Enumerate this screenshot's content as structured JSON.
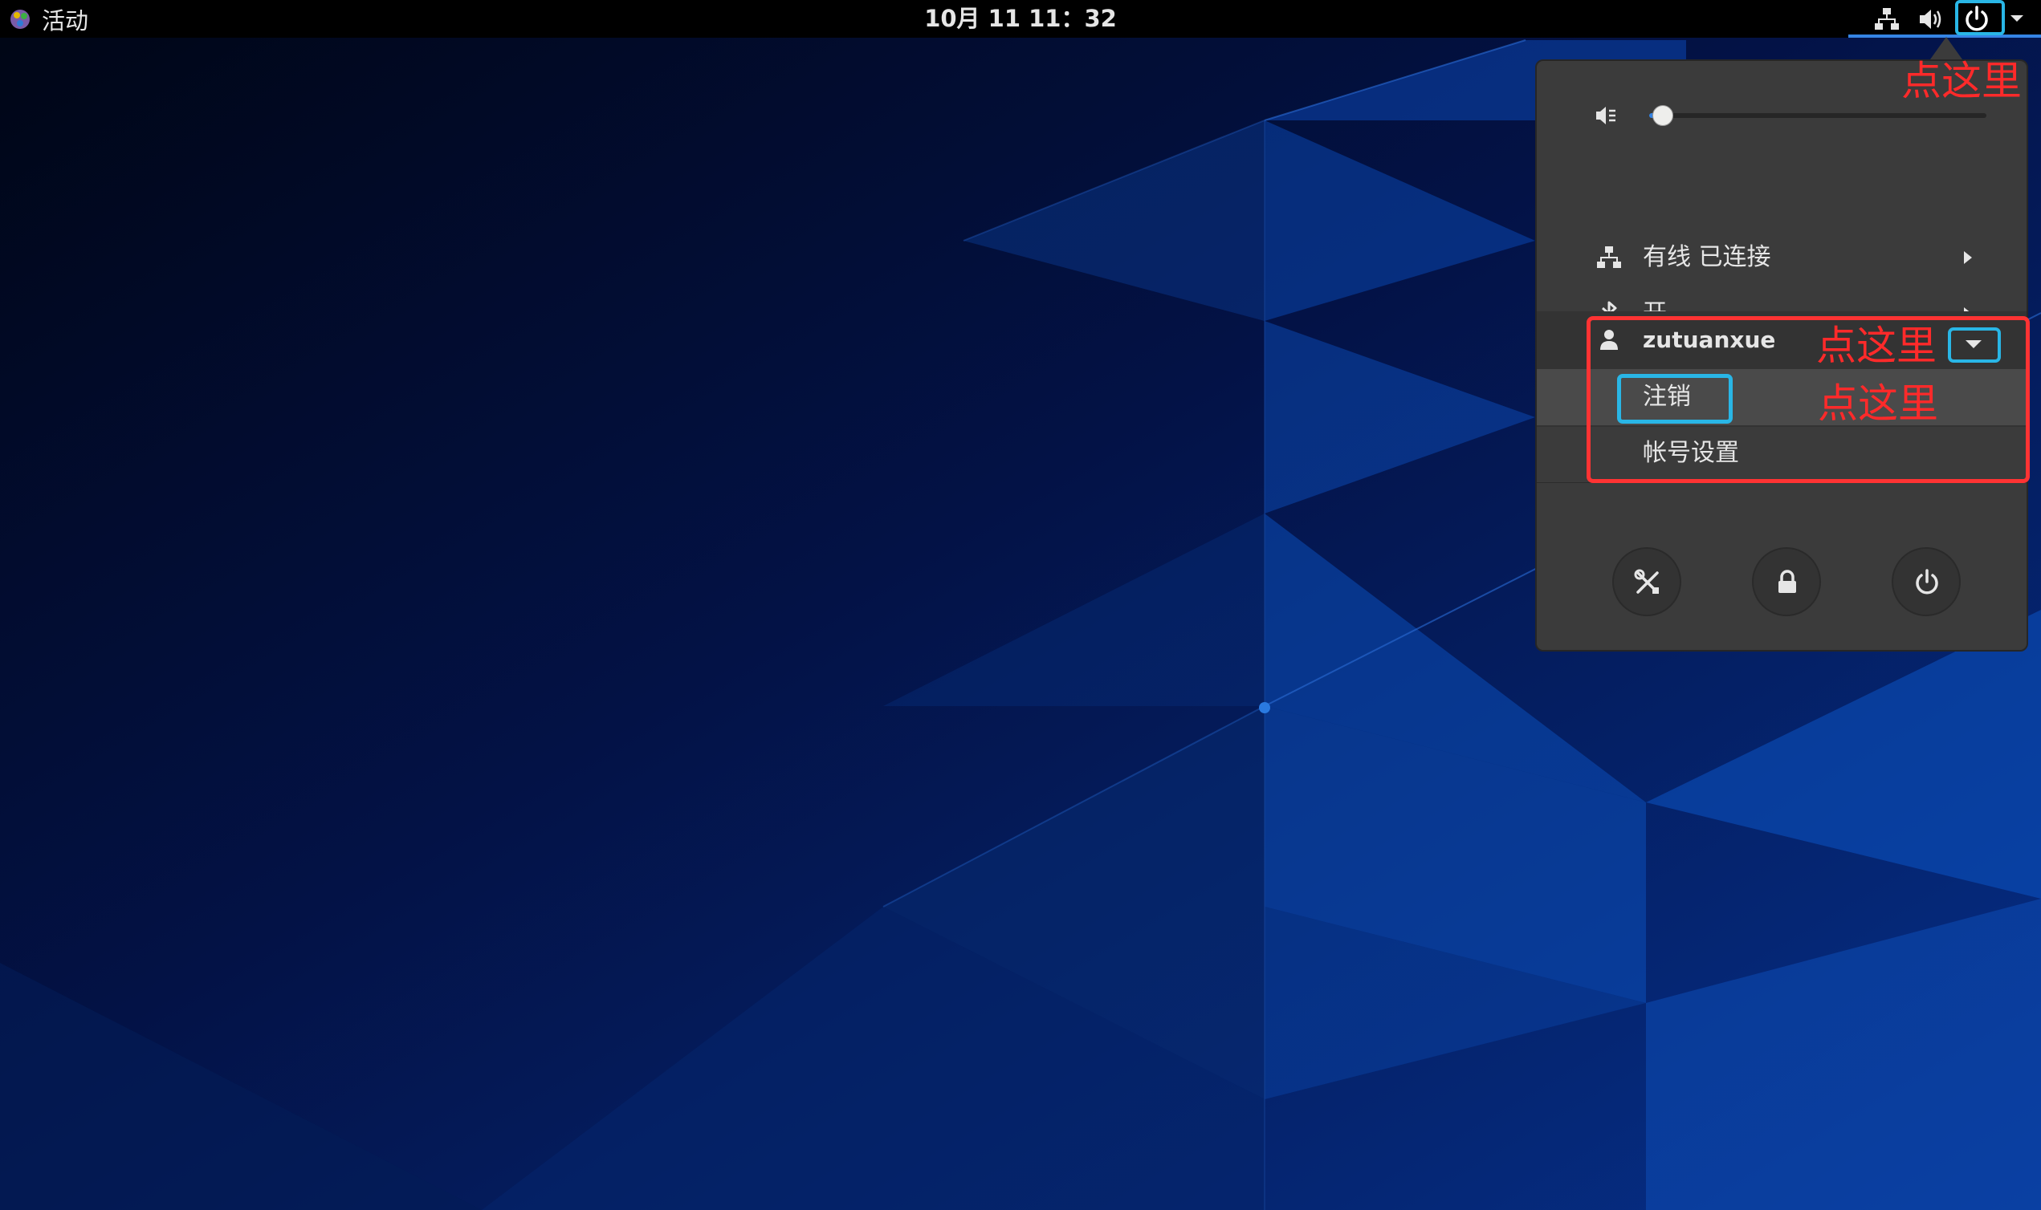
{
  "topbar": {
    "activities_label": "活动",
    "clock": "10月 11  11：32"
  },
  "menu": {
    "volume": {
      "level": 0.04
    },
    "network_label": "有线 已连接",
    "bluetooth_label": "开",
    "user_name": "zutuanxue",
    "logout_label": "注销",
    "account_settings_label": "帐号设置"
  },
  "annotations": {
    "hint_top": "点这里",
    "hint_user": "点这里",
    "hint_logout": "点这里"
  },
  "colors": {
    "accent": "#3584e4",
    "annotation_red": "#ff2a2a",
    "annotation_blue": "#29b6e6",
    "menu_background": "#3b3b3b"
  },
  "icons": {
    "activities": "activities-icon",
    "network": "network-wired-icon",
    "volume": "volume-icon",
    "power": "power-icon",
    "volume_muted": "volume-muted-icon",
    "bluetooth": "bluetooth-icon",
    "user": "user-icon",
    "settings": "settings-icon",
    "lock": "lock-icon",
    "power_off": "power-off-icon"
  }
}
